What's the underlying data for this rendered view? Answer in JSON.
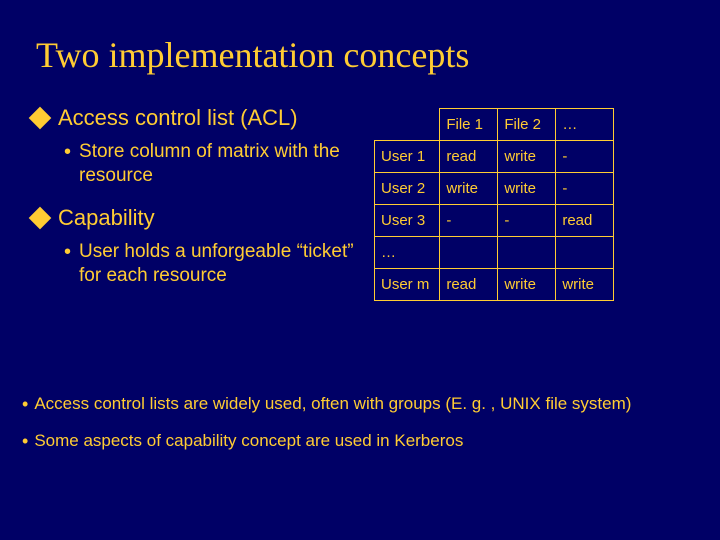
{
  "title": "Two implementation concepts",
  "acl": {
    "heading": "Access control list (ACL)",
    "sub": "Store column of matrix with the resource"
  },
  "cap": {
    "heading": "Capability",
    "sub": "User holds a unforgeable “ticket” for each resource"
  },
  "table": {
    "cols": [
      "File 1",
      "File 2",
      "…"
    ],
    "rows": [
      {
        "label": "User 1",
        "cells": [
          "read",
          "write",
          "-"
        ]
      },
      {
        "label": "User 2",
        "cells": [
          "write",
          "write",
          "-"
        ]
      },
      {
        "label": "User 3",
        "cells": [
          "-",
          "-",
          "read"
        ]
      },
      {
        "label": "…",
        "cells": [
          "",
          "",
          ""
        ]
      },
      {
        "label": "User m",
        "cells": [
          "read",
          "write",
          "write"
        ]
      }
    ]
  },
  "footer1": "Access control lists are widely used, often with groups (E. g. , UNIX file system)",
  "footer2": "Some aspects of capability concept are used in Kerberos"
}
